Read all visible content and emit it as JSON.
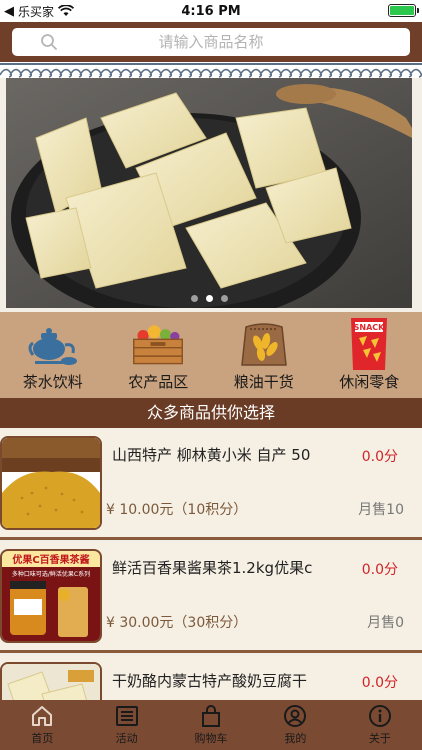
{
  "status_bar": {
    "back_app": "乐买家",
    "time": "4:16 PM"
  },
  "search": {
    "placeholder": "请输入商品名称"
  },
  "banner": {
    "page_count": 3,
    "active_page": 1
  },
  "categories": [
    {
      "label": "茶水饮料",
      "icon": "teapot-icon"
    },
    {
      "label": "农产品区",
      "icon": "produce-crate-icon"
    },
    {
      "label": "粮油干货",
      "icon": "grain-sack-icon"
    },
    {
      "label": "休闲零食",
      "icon": "snack-bag-icon"
    }
  ],
  "section_title": "众多商品供你选择",
  "products": [
    {
      "title": "山西特产 柳林黄小米 自产 50",
      "points": "0.0分",
      "price": "¥ 10.00元（10积分）",
      "sales": "月售10"
    },
    {
      "title": "鲜活百香果酱果茶1.2kg优果c",
      "points": "0.0分",
      "price": "¥ 30.00元（30积分）",
      "sales": "月售0",
      "thumb_text_1": "优果C百香果茶酱",
      "thumb_text_2": "多种口味可选/鲜活优果C系列"
    },
    {
      "title": "干奶酪内蒙古特产酸奶豆腐干",
      "points": "0.0分"
    }
  ],
  "tabs": [
    {
      "label": "首页",
      "icon": "home-icon"
    },
    {
      "label": "活动",
      "icon": "list-icon"
    },
    {
      "label": "购物车",
      "icon": "cart-bag-icon"
    },
    {
      "label": "我的",
      "icon": "user-icon"
    },
    {
      "label": "关于",
      "icon": "info-icon"
    }
  ],
  "colors": {
    "header": "#6f3f2a",
    "category_bg": "#c9a27f",
    "section_bg": "#6a3b25",
    "tabbar_bg": "#7a4a33",
    "points_red": "#d0242a"
  }
}
